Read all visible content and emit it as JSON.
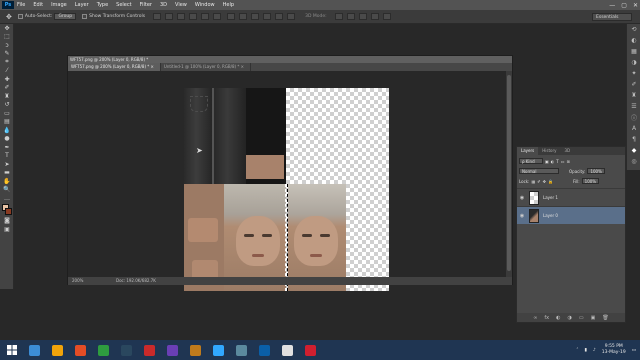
{
  "app": {
    "logo": "Ps"
  },
  "menu": [
    "File",
    "Edit",
    "Image",
    "Layer",
    "Type",
    "Select",
    "Filter",
    "3D",
    "View",
    "Window",
    "Help"
  ],
  "window_controls": [
    "—",
    "▢",
    "✕"
  ],
  "options": {
    "auto_select_label": "Auto-Select:",
    "auto_select_value": "Group",
    "show_transform": "Show Transform Controls",
    "mode_3d": "3D Mode:",
    "workspace": "Essentials"
  },
  "document": {
    "title": "WFT57.png @ 200% (Layer 0, RGB/8) *",
    "tabs": [
      {
        "label": "WFT57.png @ 200% (Layer 0, RGB/8) *  ×"
      },
      {
        "label": "Untitled-1 @ 100% (Layer 0, RGB/8) *  ×"
      }
    ],
    "zoom": "200%",
    "doc_info": "Doc: 192.0K/682.7K"
  },
  "layers_panel": {
    "tabs": [
      "Layers",
      "History",
      "3D"
    ],
    "kind": "ρ Kind",
    "blend_mode": "Normal",
    "opacity_label": "Opacity:",
    "opacity": "100%",
    "lock_label": "Lock:",
    "fill_label": "Fill:",
    "fill": "100%",
    "layers": [
      {
        "name": "Layer 1"
      },
      {
        "name": "Layer 0"
      }
    ],
    "footer_icons": [
      "∞",
      "fx",
      "◐",
      "◑",
      "▭",
      "▣",
      "🗑"
    ]
  },
  "taskbar": {
    "apps": [
      {
        "color": "#3c8dd6"
      },
      {
        "color": "#f0a30a"
      },
      {
        "color": "#e44d26"
      },
      {
        "color": "#2e9c3f"
      },
      {
        "color": "#2a475e"
      },
      {
        "color": "#c92a2a"
      },
      {
        "color": "#6a3fb5"
      },
      {
        "color": "#bf7b1c"
      },
      {
        "color": "#31a8ff"
      },
      {
        "color": "#5b8a9e"
      },
      {
        "color": "#0a5fa8"
      },
      {
        "color": "#e0e0e0"
      },
      {
        "color": "#d01f2f"
      }
    ],
    "time": "9:55 PM",
    "date": "13-May-19"
  },
  "colors": {
    "accent": "#31a8ff",
    "selected_layer": "#5a6f8a"
  }
}
